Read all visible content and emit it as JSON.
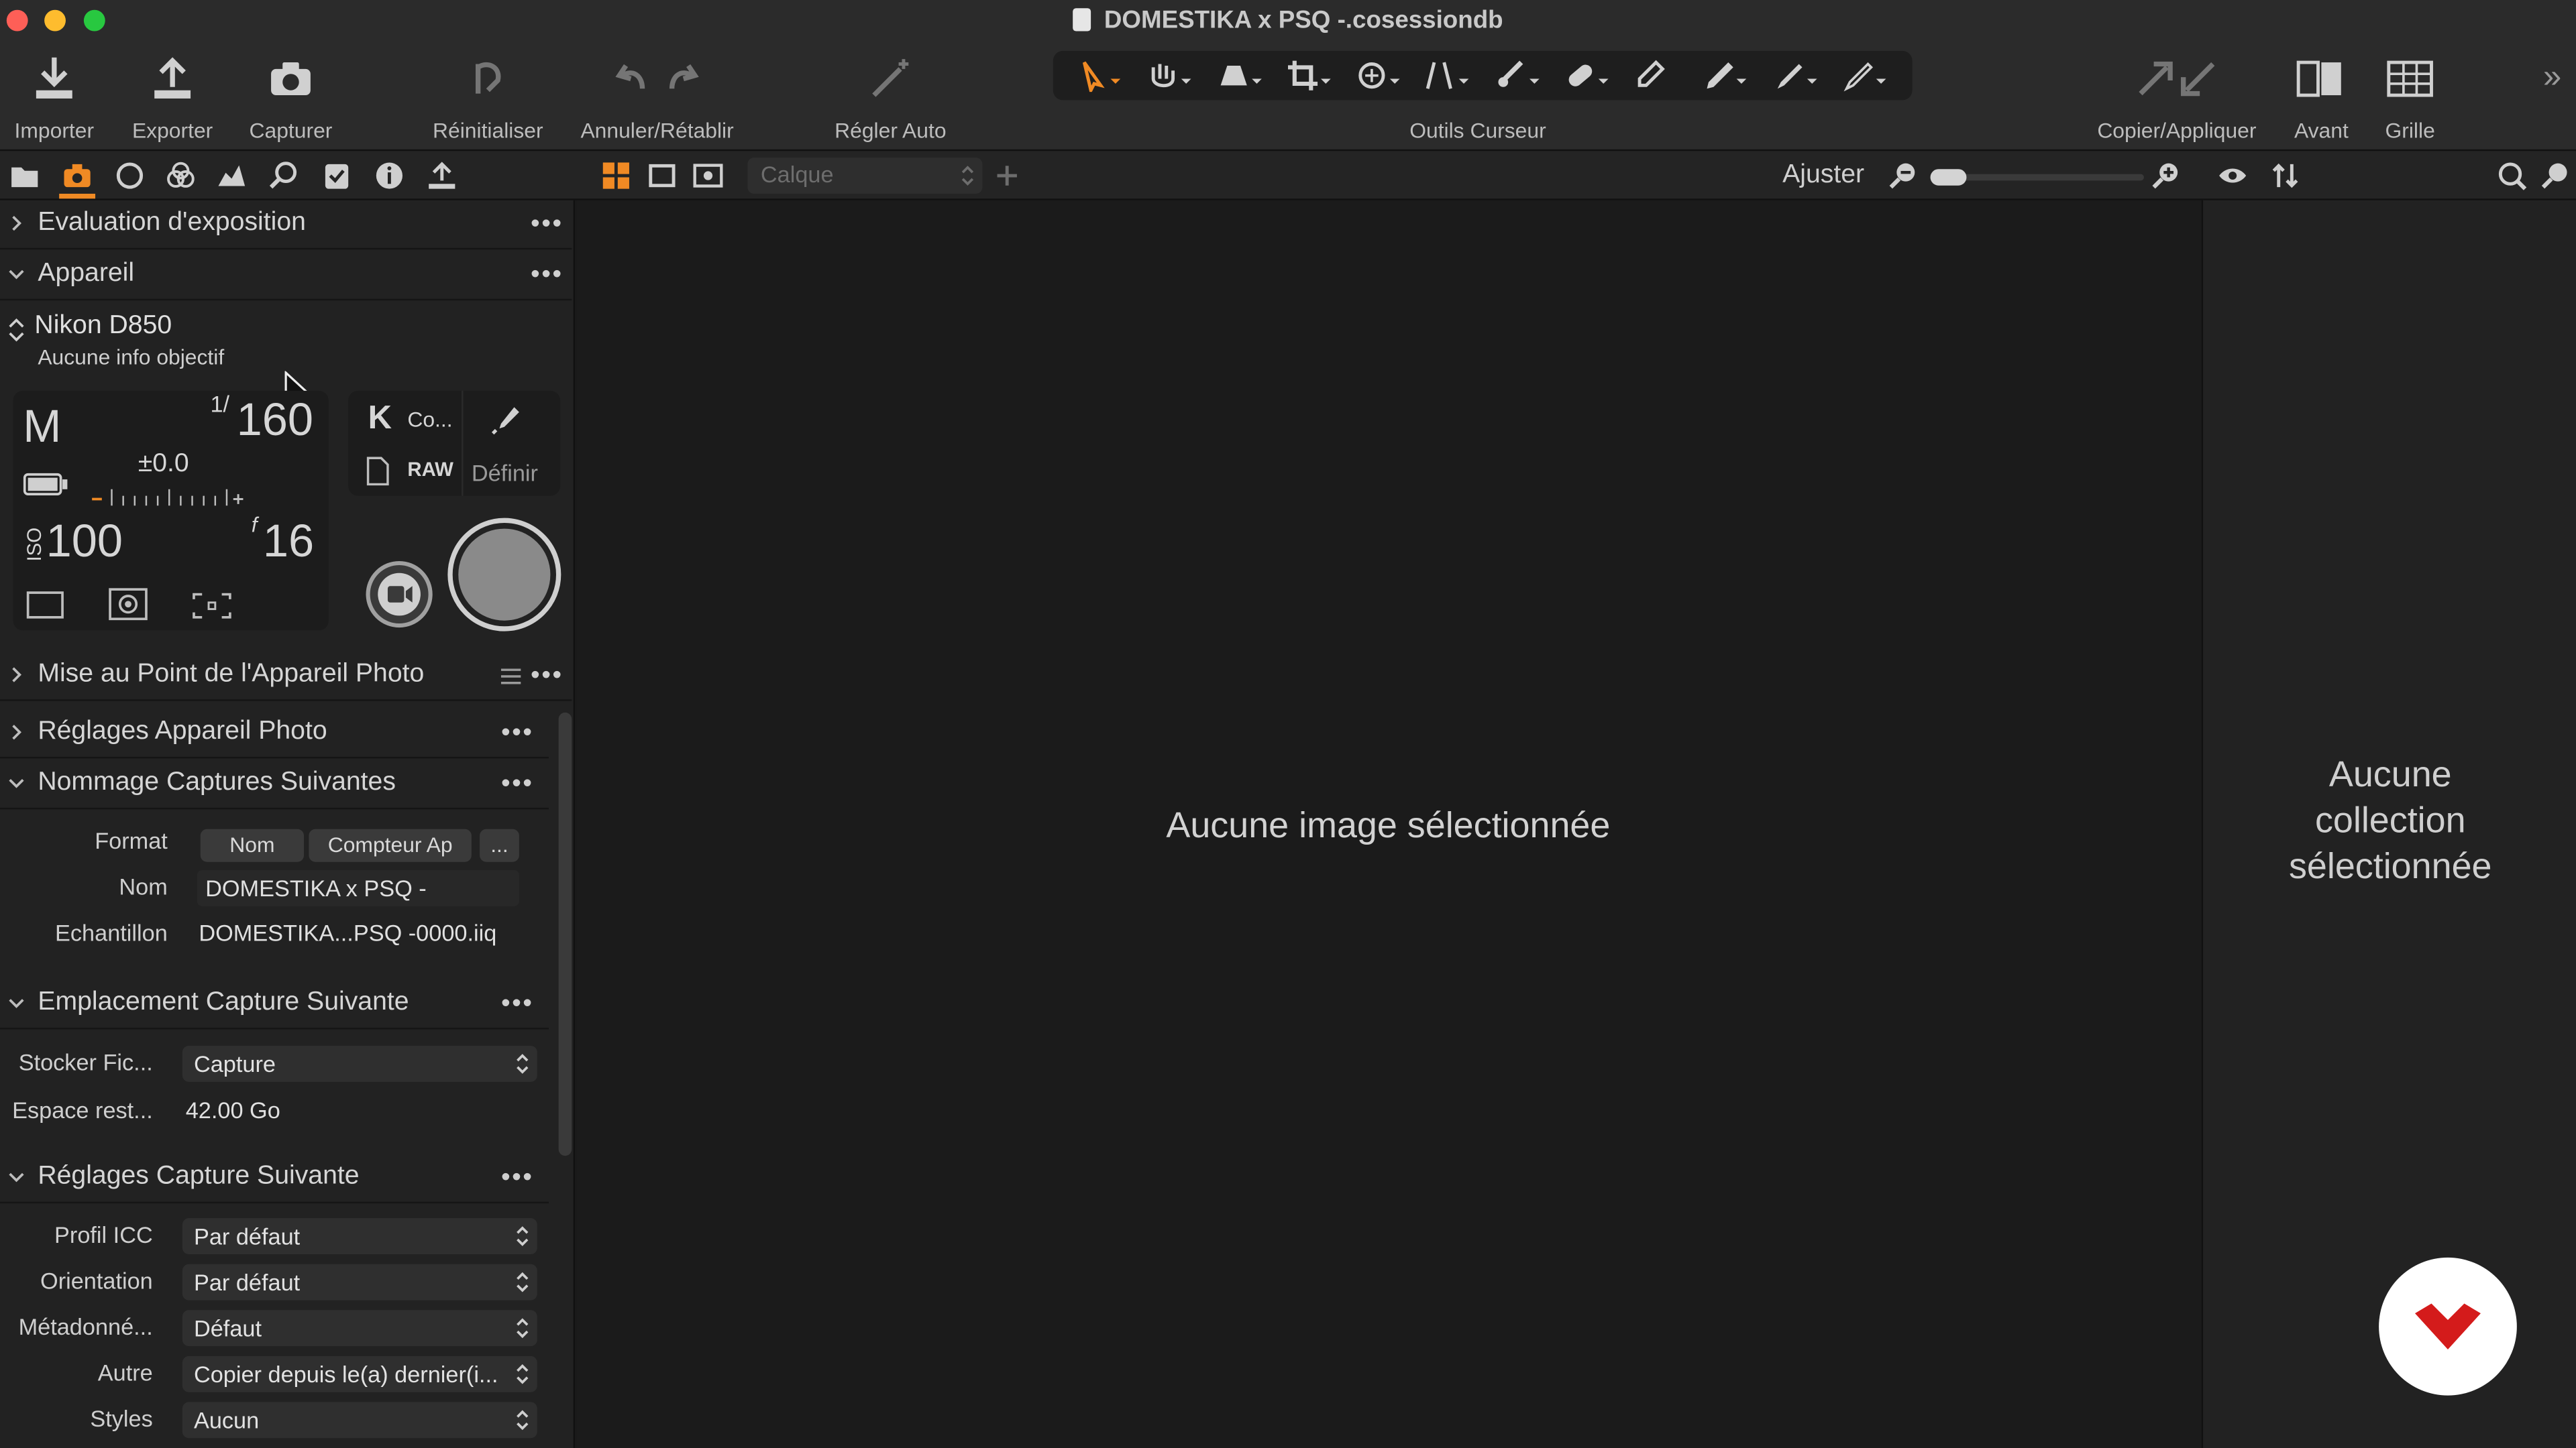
{
  "window": {
    "title": "DOMESTIKA x PSQ -.cosessiondb"
  },
  "toolbar": {
    "import": "Importer",
    "export": "Exporter",
    "capture": "Capturer",
    "reset": "Réinitialiser",
    "undo_redo": "Annuler/Rétablir",
    "auto_adjust": "Régler Auto",
    "cursor_tools": "Outils Curseur",
    "copy_apply": "Copier/Appliquer",
    "before": "Avant",
    "grid": "Grille",
    "overflow": "»"
  },
  "viewer_bar": {
    "layer_placeholder": "Calque",
    "fit": "Ajuster"
  },
  "colors": {
    "accent": "#f08a24",
    "traffic_red": "#fe5f57",
    "traffic_yellow": "#febc2e",
    "traffic_green": "#28c840",
    "brand_red": "#d41b1b"
  },
  "left": {
    "exposure": {
      "title": "Evaluation d'exposition"
    },
    "camera": {
      "title": "Appareil",
      "model": "Nikon D850",
      "lens": "Aucune info objectif",
      "mode": "M",
      "shutter_num": "1/",
      "shutter_den": "160",
      "ev": "±0.0",
      "iso_label": "ISO",
      "iso": "100",
      "f_label": "f",
      "aperture": "16",
      "wb": "K",
      "wb_value": "Co...",
      "format": "RAW",
      "define": "Définir"
    },
    "focus": {
      "title": "Mise au Point de l'Appareil Photo"
    },
    "settings": {
      "title": "Réglages Appareil Photo"
    },
    "naming": {
      "title": "Nommage Captures Suivantes",
      "format_label": "Format",
      "chip_name": "Nom",
      "chip_counter": "Compteur Ap",
      "more": "...",
      "name_label": "Nom",
      "name_value": "DOMESTIKA x PSQ -",
      "sample_label": "Echantillon",
      "sample_value": "DOMESTIKA...PSQ -0000.iiq"
    },
    "location": {
      "title": "Emplacement Capture Suivante",
      "store_label": "Stocker Fic...",
      "store_value": "Capture",
      "space_label": "Espace rest...",
      "space_value": "42.00 Go"
    },
    "next_settings": {
      "title": "Réglages Capture Suivante",
      "icc_label": "Profil ICC",
      "icc_value": "Par défaut",
      "orientation_label": "Orientation",
      "orientation_value": "Par défaut",
      "metadata_label": "Métadonné...",
      "metadata_value": "Défaut",
      "other_label": "Autre",
      "other_value": "Copier depuis le(a) dernier(i...",
      "styles_label": "Styles",
      "styles_value": "Aucun"
    }
  },
  "center": {
    "message": "Aucune image sélectionnée"
  },
  "right": {
    "message_line1": "Aucune",
    "message_line2": "collection",
    "message_line3": "sélectionnée"
  }
}
